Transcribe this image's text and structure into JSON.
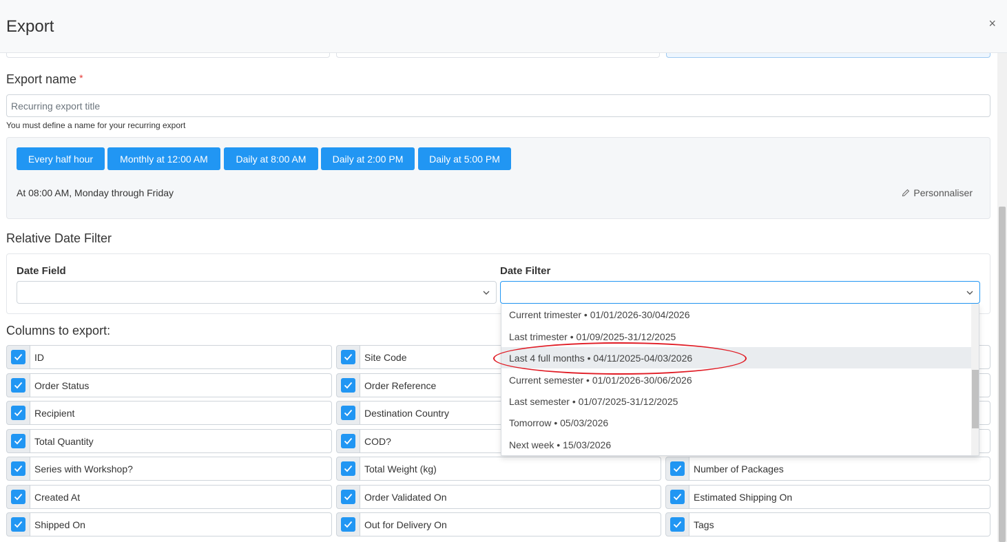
{
  "header": {
    "title": "Export",
    "close": "×"
  },
  "export_name": {
    "label": "Export name",
    "required_mark": "*",
    "placeholder": "Recurring export title",
    "help": "You must define a name for your recurring export"
  },
  "schedule": {
    "presets": [
      "Every half hour",
      "Monthly at 12:00 AM",
      "Daily at 8:00 AM",
      "Daily at 2:00 PM",
      "Daily at 5:00 PM"
    ],
    "description": "At 08:00 AM, Monday through Friday",
    "customize_label": "Personnaliser"
  },
  "relative_date_filter": {
    "title": "Relative Date Filter",
    "date_field_label": "Date Field",
    "date_filter_label": "Date Filter"
  },
  "dropdown": {
    "options": [
      "Current trimester • 01/01/2026-30/04/2026",
      "Last trimester • 01/09/2025-31/12/2025",
      "Last 4 full months • 04/11/2025-04/03/2026",
      "Current semester • 01/01/2026-30/06/2026",
      "Last semester • 01/07/2025-31/12/2025",
      "Tomorrow • 05/03/2026",
      "Next week • 15/03/2026"
    ],
    "highlighted_index": 2
  },
  "columns": {
    "title": "Columns to export:",
    "col1": [
      "ID",
      "Order Status",
      "Recipient",
      "Total Quantity",
      "Series with Workshop?",
      "Created At",
      "Shipped On"
    ],
    "col2": [
      "Site Code",
      "Order Reference",
      "Destination Country",
      "COD?",
      "Total Weight (kg)",
      "Order Validated On",
      "Out for Delivery On"
    ],
    "col3": [
      "",
      "",
      "",
      "",
      "Number of Packages",
      "Estimated Shipping On",
      "Tags"
    ]
  },
  "colors": {
    "accent": "#2196f3",
    "annotation": "#e01b24"
  }
}
